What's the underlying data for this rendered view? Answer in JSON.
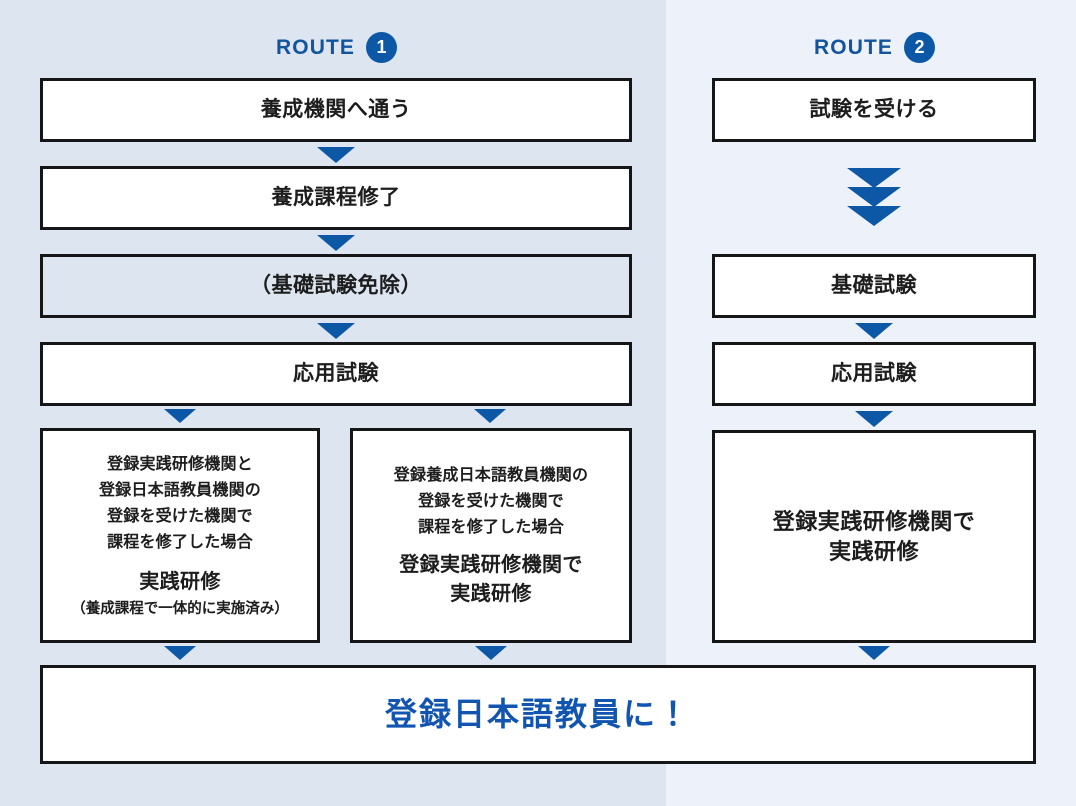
{
  "routes": [
    {
      "label": "ROUTE",
      "number": "1"
    },
    {
      "label": "ROUTE",
      "number": "2"
    }
  ],
  "colors": {
    "panel_left_bg": "#dce5f0",
    "panel_right_bg": "#edf1f9",
    "accent_blue": "#0d57a7",
    "route_text_blue": "#12549e",
    "goal_text_blue": "#1155b0",
    "box_border": "#161616",
    "box_fill": "#ffffff",
    "body_text": "#1d1d1d"
  },
  "route1": {
    "step1": "養成機関へ通う",
    "step2": "養成課程修了",
    "step3": "（基礎試験免除）",
    "step4": "応用試験",
    "branch_a": {
      "lines": [
        "登録実践研修機関と",
        "登録日本語教員機関の",
        "登録を受けた機関で",
        "課程を修了した場合"
      ],
      "emphasis": "実践研修",
      "note": "（養成課程で一体的に実施済み）"
    },
    "branch_b": {
      "lines": [
        "登録養成日本語教員機関の",
        "登録を受けた機関で",
        "課程を修了した場合"
      ],
      "emphasis_lines": [
        "登録実践研修機関で",
        "実践研修"
      ]
    }
  },
  "route2": {
    "step1": "試験を受ける",
    "step2": "基礎試験",
    "step3": "応用試験",
    "step4_lines": [
      "登録実践研修機関で",
      "実践研修"
    ]
  },
  "goal": "登録日本語教員に！",
  "icons": {
    "arrow_down": "down-arrow-icon",
    "chevron_stack": "triple-chevron-down-icon"
  }
}
